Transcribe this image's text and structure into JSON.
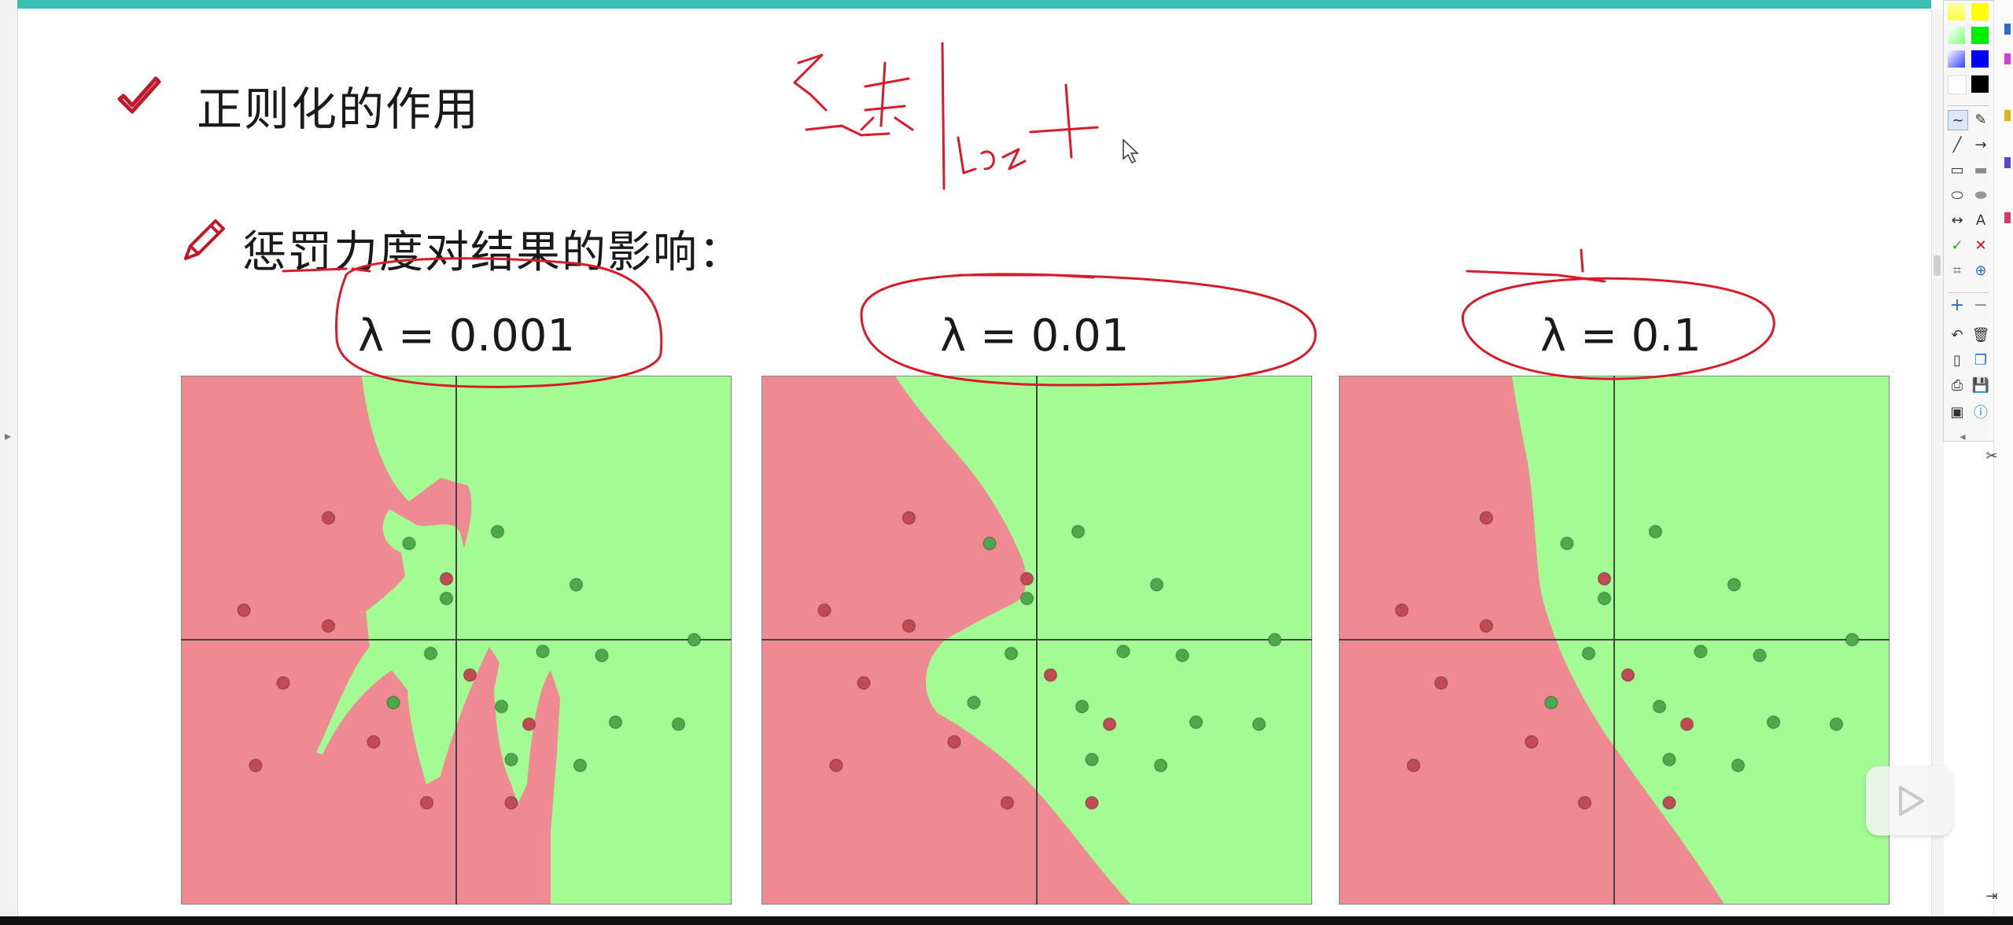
{
  "slide": {
    "title": "正则化的作用",
    "subtitle": "惩罚力度对结果的影响："
  },
  "panels": [
    {
      "label": "λ = 0.001",
      "red_points": [
        [
          -0.65,
          0.62
        ],
        [
          -1.08,
          0.15
        ],
        [
          -0.65,
          0.07
        ],
        [
          -0.88,
          -0.22
        ],
        [
          -0.42,
          -0.52
        ],
        [
          -1.02,
          -0.64
        ],
        [
          -0.15,
          -0.83
        ],
        [
          0.28,
          -0.83
        ],
        [
          -0.05,
          0.31
        ],
        [
          0.07,
          -0.18
        ],
        [
          0.37,
          -0.43
        ]
      ],
      "green_points": [
        [
          -0.24,
          0.49
        ],
        [
          0.21,
          0.55
        ],
        [
          0.61,
          0.28
        ],
        [
          -0.05,
          0.21
        ],
        [
          -0.13,
          -0.07
        ],
        [
          0.44,
          -0.06
        ],
        [
          0.74,
          -0.08
        ],
        [
          1.21,
          0.0
        ],
        [
          -0.32,
          -0.32
        ],
        [
          0.23,
          -0.34
        ],
        [
          0.81,
          -0.42
        ],
        [
          1.13,
          -0.43
        ],
        [
          0.28,
          -0.61
        ],
        [
          0.63,
          -0.64
        ]
      ]
    },
    {
      "label": "λ = 0.01",
      "red_points": [
        [
          -0.65,
          0.62
        ],
        [
          -1.08,
          0.15
        ],
        [
          -0.65,
          0.07
        ],
        [
          -0.88,
          -0.22
        ],
        [
          -0.42,
          -0.52
        ],
        [
          -1.02,
          -0.64
        ],
        [
          -0.15,
          -0.83
        ],
        [
          0.28,
          -0.83
        ],
        [
          -0.05,
          0.31
        ],
        [
          0.07,
          -0.18
        ],
        [
          0.37,
          -0.43
        ]
      ],
      "green_points": [
        [
          -0.24,
          0.49
        ],
        [
          0.21,
          0.55
        ],
        [
          0.61,
          0.28
        ],
        [
          -0.05,
          0.21
        ],
        [
          -0.13,
          -0.07
        ],
        [
          0.44,
          -0.06
        ],
        [
          0.74,
          -0.08
        ],
        [
          1.21,
          0.0
        ],
        [
          -0.32,
          -0.32
        ],
        [
          0.23,
          -0.34
        ],
        [
          0.81,
          -0.42
        ],
        [
          1.13,
          -0.43
        ],
        [
          0.28,
          -0.61
        ],
        [
          0.63,
          -0.64
        ]
      ]
    },
    {
      "label": "λ = 0.1",
      "red_points": [
        [
          -0.65,
          0.62
        ],
        [
          -1.08,
          0.15
        ],
        [
          -0.65,
          0.07
        ],
        [
          -0.88,
          -0.22
        ],
        [
          -0.42,
          -0.52
        ],
        [
          -1.02,
          -0.64
        ],
        [
          -0.15,
          -0.83
        ],
        [
          0.28,
          -0.83
        ],
        [
          -0.05,
          0.31
        ],
        [
          0.07,
          -0.18
        ],
        [
          0.37,
          -0.43
        ]
      ],
      "green_points": [
        [
          -0.24,
          0.49
        ],
        [
          0.21,
          0.55
        ],
        [
          0.61,
          0.28
        ],
        [
          -0.05,
          0.21
        ],
        [
          -0.13,
          -0.07
        ],
        [
          0.44,
          -0.06
        ],
        [
          0.74,
          -0.08
        ],
        [
          1.21,
          0.0
        ],
        [
          -0.32,
          -0.32
        ],
        [
          0.23,
          -0.34
        ],
        [
          0.81,
          -0.42
        ],
        [
          1.13,
          -0.43
        ],
        [
          0.28,
          -0.61
        ],
        [
          0.63,
          -0.64
        ]
      ]
    }
  ],
  "colors": {
    "red_region": "#ef8a93",
    "green_region": "#a2fb93",
    "red_point": "#c24a55",
    "green_point": "#4caa4a",
    "ink": "#d81b2c",
    "topbar": "#3cbfb2"
  },
  "toolbar": {
    "tools": [
      "pen-icon",
      "eraser-icon",
      "line-icon",
      "arrow-icon",
      "rectangle-icon",
      "filled-rectangle-icon",
      "ellipse-icon",
      "filled-ellipse-icon",
      "double-arrow-icon",
      "text-icon",
      "check-icon",
      "cross-icon",
      "crop-icon",
      "zoom-icon",
      "plus-icon",
      "minus-icon",
      "undo-icon",
      "trash-icon",
      "new-page-icon",
      "copy-icon",
      "print-icon",
      "save-icon",
      "screen-icon",
      "info-icon"
    ],
    "text_tool_label": "A"
  }
}
